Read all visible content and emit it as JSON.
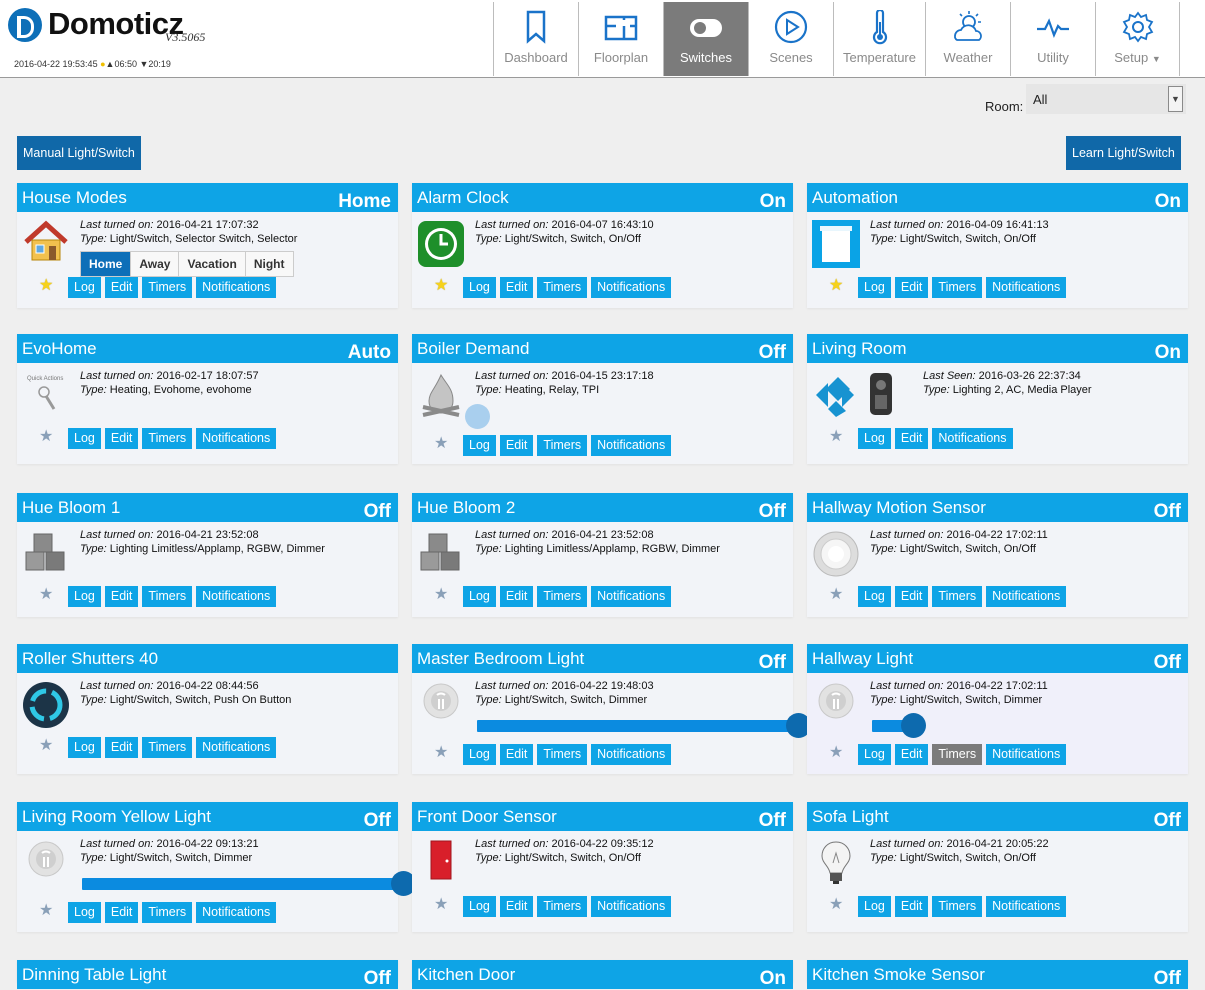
{
  "app": {
    "name": "Domoticz",
    "version": "V3.5065",
    "date_time": "2016-04-22 19:53:45",
    "sunrise": "▲06:50",
    "sunset": "▼20:19"
  },
  "nav": {
    "items": [
      {
        "label": "Dashboard",
        "icon": "bookmark-icon",
        "active": false
      },
      {
        "label": "Floorplan",
        "icon": "floorplan-icon",
        "active": false
      },
      {
        "label": "Switches",
        "icon": "toggle-icon",
        "active": true
      },
      {
        "label": "Scenes",
        "icon": "play-icon",
        "active": false
      },
      {
        "label": "Temperature",
        "icon": "thermometer-icon",
        "active": false
      },
      {
        "label": "Weather",
        "icon": "weather-icon",
        "active": false
      },
      {
        "label": "Utility",
        "icon": "pulse-icon",
        "active": false
      },
      {
        "label": "Setup",
        "icon": "gear-icon",
        "active": false
      }
    ]
  },
  "filter": {
    "room_label": "Room:",
    "room_value": "All"
  },
  "actions": {
    "manual": "Manual Light/Switch",
    "learn": "Learn Light/Switch"
  },
  "card_buttons": {
    "log": "Log",
    "edit": "Edit",
    "timers": "Timers",
    "notifications": "Notifications"
  },
  "devices": [
    {
      "title": "House Modes",
      "status": "Home",
      "last_label": "Last turned on:",
      "last": "2016-04-21 17:07:32",
      "type_label": "Type:",
      "type": "Light/Switch, Selector Switch, Selector",
      "favorite": true,
      "icon": "house-icon",
      "selector": [
        "Home",
        "Away",
        "Vacation",
        "Night"
      ],
      "selector_active": "Home"
    },
    {
      "title": "Alarm Clock",
      "status": "On",
      "last_label": "Last turned on:",
      "last": "2016-04-07 16:43:10",
      "type_label": "Type:",
      "type": "Light/Switch, Switch, On/Off",
      "favorite": true,
      "icon": "clock-icon"
    },
    {
      "title": "Automation",
      "status": "On",
      "last_label": "Last turned on:",
      "last": "2016-04-09 16:41:13",
      "type_label": "Type:",
      "type": "Light/Switch, Switch, On/Off",
      "favorite": true,
      "icon": "blinds-icon"
    },
    {
      "title": "EvoHome",
      "status": "Auto",
      "last_label": "Last turned on:",
      "last": "2016-02-17 18:07:57",
      "type_label": "Type:",
      "type": "Heating, Evohome, evohome",
      "favorite": false,
      "icon": "quick-actions-icon",
      "icon_caption": "Quick Actions"
    },
    {
      "title": "Boiler Demand",
      "status": "Off",
      "last_label": "Last turned on:",
      "last": "2016-04-15 23:17:18",
      "type_label": "Type:",
      "type": "Heating, Relay, TPI",
      "favorite": false,
      "icon": "fire-icon"
    },
    {
      "title": "Living Room",
      "status": "On",
      "last_label": "Last Seen:",
      "last": "2016-03-26 22:37:34",
      "type_label": "Type:",
      "type": "Lighting 2, AC, Media Player",
      "favorite": false,
      "icon": "media-player-icon"
    },
    {
      "title": "Hue Bloom 1",
      "status": "Off",
      "last_label": "Last turned on:",
      "last": "2016-04-21 23:52:08",
      "type_label": "Type:",
      "type": "Lighting Limitless/Applamp, RGBW, Dimmer",
      "favorite": false,
      "icon": "rgbw-cubes-icon"
    },
    {
      "title": "Hue Bloom 2",
      "status": "Off",
      "last_label": "Last turned on:",
      "last": "2016-04-21 23:52:08",
      "type_label": "Type:",
      "type": "Lighting Limitless/Applamp, RGBW, Dimmer",
      "favorite": false,
      "icon": "rgbw-cubes-icon"
    },
    {
      "title": "Hallway Motion Sensor",
      "status": "Off",
      "last_label": "Last turned on:",
      "last": "2016-04-22 17:02:11",
      "type_label": "Type:",
      "type": "Light/Switch, Switch, On/Off",
      "favorite": false,
      "icon": "motion-sensor-icon"
    },
    {
      "title": "Roller Shutters 40",
      "status": "",
      "last_label": "Last turned on:",
      "last": "2016-04-22 08:44:56",
      "type_label": "Type:",
      "type": "Light/Switch, Switch, Push On Button",
      "favorite": false,
      "icon": "push-button-icon"
    },
    {
      "title": "Master Bedroom Light",
      "status": "Off",
      "last_label": "Last turned on:",
      "last": "2016-04-22 19:48:03",
      "type_label": "Type:",
      "type": "Light/Switch, Switch, Dimmer",
      "favorite": false,
      "icon": "bulb-off-icon",
      "dimmer_level": 1.0
    },
    {
      "title": "Hallway Light",
      "status": "Off",
      "last_label": "Last turned on:",
      "last": "2016-04-22 17:02:11",
      "type_label": "Type:",
      "type": "Light/Switch, Switch, Dimmer",
      "favorite": false,
      "icon": "bulb-off-icon",
      "dimmer_level": 0.14
    },
    {
      "title": "Living Room Yellow Light",
      "status": "Off",
      "last_label": "Last turned on:",
      "last": "2016-04-22 09:13:21",
      "type_label": "Type:",
      "type": "Light/Switch, Switch, Dimmer",
      "favorite": false,
      "icon": "bulb-off-icon",
      "dimmer_level": 1.0
    },
    {
      "title": "Front Door Sensor",
      "status": "Off",
      "last_label": "Last turned on:",
      "last": "2016-04-22 09:35:12",
      "type_label": "Type:",
      "type": "Light/Switch, Switch, On/Off",
      "favorite": false,
      "icon": "door-icon"
    },
    {
      "title": "Sofa Light",
      "status": "Off",
      "last_label": "Last turned on:",
      "last": "2016-04-21 20:05:22",
      "type_label": "Type:",
      "type": "Light/Switch, Switch, On/Off",
      "favorite": false,
      "icon": "lightbulb-icon"
    },
    {
      "title": "Dinning Table Light",
      "status": "Off"
    },
    {
      "title": "Kitchen Door",
      "status": "On"
    },
    {
      "title": "Kitchen Smoke Sensor",
      "status": "Off"
    }
  ],
  "colors": {
    "header_blue": "#0ea4e6",
    "nav_active": "#7b7b7b",
    "action_blue": "#1068a8",
    "slider_knob": "#0d6aae"
  }
}
